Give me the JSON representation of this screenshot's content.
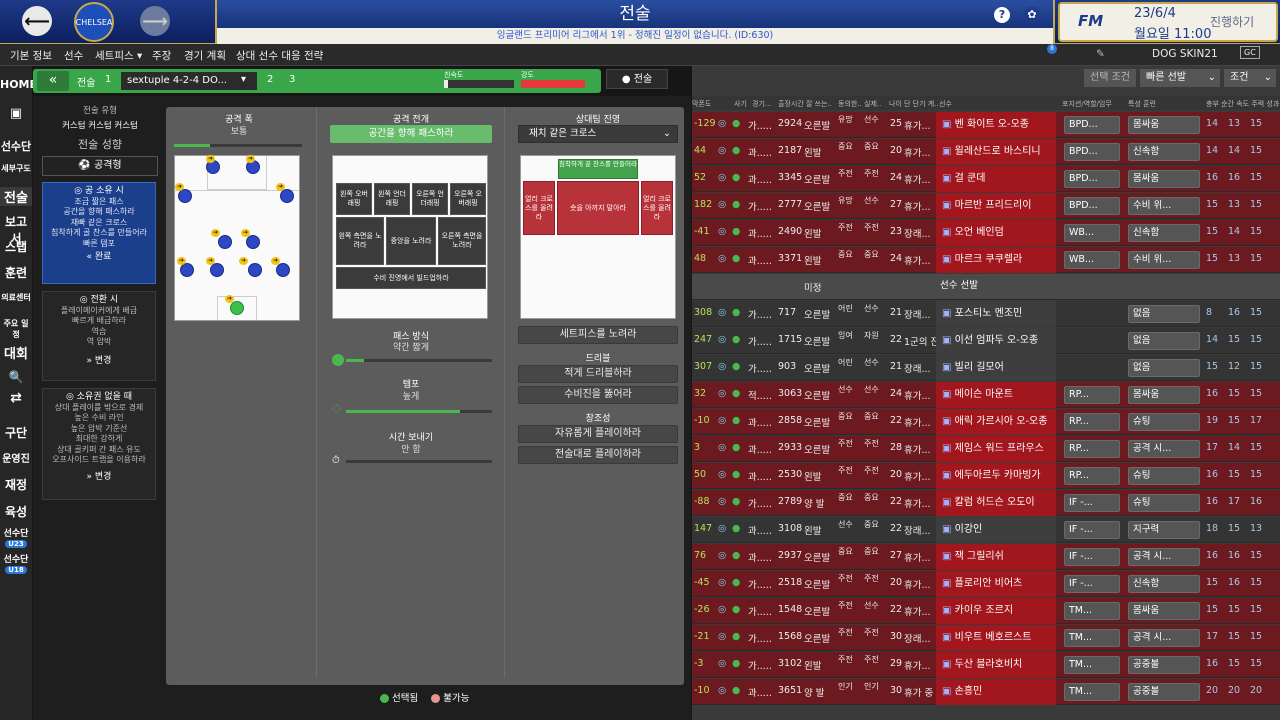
{
  "header": {
    "title": "전술",
    "subtitle": "잉글랜드 프리미어 리그에서 1위 - 정해진 일정이 없습니다. (ID:630)",
    "club_crest_text": "CHELSEA",
    "date": "23/6/4",
    "day_time": "월요일 11:00",
    "continue_label": "진행하기",
    "brand": "FM",
    "help_label": "?",
    "back_label": "⟵",
    "forward_label": "⟶"
  },
  "tabs": [
    "기본 정보",
    "선수",
    "세트피스 ▾",
    "주장",
    "경기 계획",
    "상대 선수 대응 전략"
  ],
  "skin_label": "DOG SKIN21",
  "sidebar": {
    "items": [
      "HOME",
      "선수단",
      "세부구도",
      "전술",
      "보고서",
      "스탭",
      "훈련",
      "의료센터",
      "주요 일정",
      "대회",
      "🔍",
      "⇄",
      "구단",
      "운영진",
      "재정",
      "육성",
      "선수단",
      "선수단"
    ],
    "badges": [
      "U23",
      "U18"
    ]
  },
  "tactic": {
    "collapse_label": "«",
    "label": "전술",
    "slot1": "1",
    "name": "sextuple 4-2-4 DO...",
    "slot2": "2",
    "slot3": "3",
    "familiarity_label": "친숙도",
    "intensity_label": "강도",
    "menu_label": "● 전술"
  },
  "left": {
    "style_label": "전술 유형",
    "style_value": "커스텀 커스텀 커스텀",
    "mentality_label": "전술 성향",
    "mentality_value": "⚽ 공격형",
    "in_possession": {
      "title": "◎ 공 소유 시",
      "lines": [
        "조금 짧은 패스",
        "공간을 향해 패스하라",
        "재빠 같은 크로스",
        "침착하게 골 찬스를 만들어라",
        "빠른 템포"
      ],
      "button": "« 완료"
    },
    "transition": {
      "title": "◎ 전환 시",
      "lines": [
        "플레이메이커에게 배급",
        "빠르게 배급하라",
        "역습",
        "역 압박"
      ],
      "button": "» 변경"
    },
    "out_possession": {
      "title": "◎ 소유권 없을 때",
      "lines": [
        "상대 플레이를 밖으로 경제",
        "높은 수비 라인",
        "높은 압박 기준선",
        "최대한 강하게",
        "상대 골키퍼 간 패스 유도",
        "오프사이드 트랩을 이용하라"
      ],
      "button": "» 변경"
    }
  },
  "main": {
    "width_title": "공격 폭",
    "width_value": "보통",
    "width_level_pct": 28,
    "attack_title": "공격 전개",
    "attack_value": "공간을 향해 패스하라",
    "zones": [
      "왼쪽 오버래핑",
      "왼쪽 언더래핑",
      "오른쪽 언더래핑",
      "오른쪽 오버래핑",
      "왼쪽 측면을 노려라",
      "중앙을 노려라",
      "오른쪽 측면을 노려라",
      "수비 진영에서 빌드업하라"
    ],
    "pass_title": "패스 방식",
    "pass_value": "약간 짧게",
    "pass_level_pct": 12,
    "tempo_title": "템포",
    "tempo_value": "높게",
    "tempo_level_pct": 78,
    "time_title": "시간 보내기",
    "time_value": "안 함",
    "time_level_pct": 0,
    "opp_title": "상대팀 진영",
    "opp_value": "재치 같은 크로스",
    "opp_zones": [
      "침착하게 골 찬스를 만들어라",
      "얼리 크로스를 올려라",
      "숏을 아끼지 말아라",
      "얼리 크로스를 올려라"
    ],
    "setpiece_btn": "세트피스를 노려라",
    "dribble_title": "드리블",
    "dribble_btns": [
      "적게 드리블하라",
      "수비진을 뚫어라"
    ],
    "creative_title": "창조성",
    "creative_btns": [
      "자유롭게 플레이하라",
      "전술대로 플레이하라"
    ],
    "legend_selected": "선택됨",
    "legend_unavailable": "불가능"
  },
  "right": {
    "filter_btn": "선택 조건",
    "quick_btn": "빠른 선발",
    "cond_btn": "조건",
    "headers": [
      "막폰도",
      "사기",
      "경기...",
      "출장시간 잘 쓰는..",
      "동의한..",
      "실제..",
      "나이",
      "단 단기 계..",
      "선수",
      "포지션/역할/임무",
      "특성 훈련",
      "충부 순간 속도 주력 성과"
    ],
    "sub_label": "미정",
    "sub_select": "선수 선발",
    "rows": [
      {
        "diff": "-129",
        "cond": "가.....",
        "val": "2924",
        "foot": "오른발",
        "a": "유망",
        "b": "선수",
        "age": "25",
        "contract": "휴가...",
        "name": "벤 화이트 오-오종",
        "role": "BPD...",
        "train": "몸싸움",
        "s1": "14",
        "s2": "13",
        "s3": "15",
        "red": true
      },
      {
        "diff": "44",
        "cond": "과.....",
        "val": "2187",
        "foot": "왼발",
        "a": "중요",
        "b": "중요",
        "age": "20",
        "contract": "휴가...",
        "name": "윌레산드로 바스티니",
        "role": "BPD...",
        "train": "신속함",
        "s1": "14",
        "s2": "14",
        "s3": "15",
        "red": true
      },
      {
        "diff": "52",
        "cond": "과.....",
        "val": "3345",
        "foot": "오른발",
        "a": "주전",
        "b": "주전",
        "age": "24",
        "contract": "휴가...",
        "name": "걸 쿤데",
        "role": "BPD...",
        "train": "몸싸움",
        "s1": "16",
        "s2": "16",
        "s3": "15",
        "red": true
      },
      {
        "diff": "182",
        "cond": "가.....",
        "val": "2777",
        "foot": "오른발",
        "a": "유망",
        "b": "선수",
        "age": "27",
        "contract": "휴가...",
        "name": "마르반 프리드리이",
        "role": "BPD...",
        "train": "수비 위...",
        "s1": "15",
        "s2": "13",
        "s3": "15",
        "red": true
      },
      {
        "diff": "-41",
        "cond": "과.....",
        "val": "2490",
        "foot": "왼발",
        "a": "주전",
        "b": "주전",
        "age": "23",
        "contract": "장래...",
        "name": "오언 베인덤",
        "role": "WB...",
        "train": "신속함",
        "s1": "15",
        "s2": "14",
        "s3": "15",
        "red": true
      },
      {
        "diff": "48",
        "cond": "과.....",
        "val": "3371",
        "foot": "왼발",
        "a": "중요",
        "b": "중요",
        "age": "24",
        "contract": "휴가...",
        "name": "마르크 쿠쿠렐라",
        "role": "WB...",
        "train": "수비 위...",
        "s1": "15",
        "s2": "13",
        "s3": "15",
        "red": true
      },
      {
        "diff": "308",
        "cond": "가.....",
        "val": "717",
        "foot": "오른발",
        "a": "어린",
        "b": "선수",
        "age": "21",
        "contract": "장래...",
        "name": "포스티노 멘조민",
        "role": "",
        "train": "없음",
        "s1": "8",
        "s2": "16",
        "s3": "15",
        "red": false
      },
      {
        "diff": "247",
        "cond": "가.....",
        "val": "1715",
        "foot": "오른발",
        "a": "잉여",
        "b": "자원",
        "age": "22",
        "contract": "1군의 잔",
        "name": "이선 엄파두 오-오종",
        "role": "",
        "train": "없음",
        "s1": "14",
        "s2": "15",
        "s3": "15",
        "red": false
      },
      {
        "diff": "307",
        "cond": "가.....",
        "val": "903",
        "foot": "오른발",
        "a": "어린",
        "b": "선수",
        "age": "21",
        "contract": "장래...",
        "name": "빌리 길모어",
        "role": "",
        "train": "없음",
        "s1": "15",
        "s2": "12",
        "s3": "15",
        "red": false
      },
      {
        "diff": "32",
        "cond": "적.....",
        "val": "3063",
        "foot": "오른발",
        "a": "선수",
        "b": "선수",
        "age": "24",
        "contract": "휴가...",
        "name": "메이슨 마운트",
        "role": "RP...",
        "train": "몸싸움",
        "s1": "16",
        "s2": "15",
        "s3": "15",
        "red": true
      },
      {
        "diff": "-10",
        "cond": "과.....",
        "val": "2858",
        "foot": "오른발",
        "a": "중요",
        "b": "중요",
        "age": "22",
        "contract": "휴가...",
        "name": "애릭 가르시아 오-오종",
        "role": "RP...",
        "train": "슈팅",
        "s1": "19",
        "s2": "15",
        "s3": "17",
        "red": true
      },
      {
        "diff": "3",
        "cond": "과.....",
        "val": "2933",
        "foot": "오른발",
        "a": "주전",
        "b": "주전",
        "age": "28",
        "contract": "휴가...",
        "name": "제임스 워드 프라우스",
        "role": "RP...",
        "train": "공격 시...",
        "s1": "17",
        "s2": "14",
        "s3": "15",
        "red": true
      },
      {
        "diff": "50",
        "cond": "과.....",
        "val": "2530",
        "foot": "왼발",
        "a": "주전",
        "b": "주전",
        "age": "20",
        "contract": "휴가...",
        "name": "에두아르두 카마빙가",
        "role": "RP...",
        "train": "슈팅",
        "s1": "16",
        "s2": "15",
        "s3": "15",
        "red": true
      },
      {
        "diff": "-88",
        "cond": "가.....",
        "val": "2789",
        "foot": "양 발",
        "a": "중요",
        "b": "중요",
        "age": "22",
        "contract": "휴가...",
        "name": "칼럼 허드슨 오도이",
        "role": "IF -...",
        "train": "슈팅",
        "s1": "16",
        "s2": "17",
        "s3": "16",
        "red": true
      },
      {
        "diff": "147",
        "cond": "과.....",
        "val": "3108",
        "foot": "왼발",
        "a": "선수",
        "b": "중요",
        "age": "22",
        "contract": "장래...",
        "name": "이강인",
        "role": "IF -...",
        "train": "지구력",
        "s1": "18",
        "s2": "15",
        "s3": "13",
        "red": false
      },
      {
        "diff": "76",
        "cond": "과.....",
        "val": "2937",
        "foot": "오른발",
        "a": "중요",
        "b": "중요",
        "age": "27",
        "contract": "휴가...",
        "name": "잭 그릴리쉬",
        "role": "IF -...",
        "train": "공격 시...",
        "s1": "16",
        "s2": "16",
        "s3": "15",
        "red": true
      },
      {
        "diff": "-45",
        "cond": "가.....",
        "val": "2518",
        "foot": "오른발",
        "a": "주전",
        "b": "주전",
        "age": "20",
        "contract": "휴가...",
        "name": "플로리안 비어츠",
        "role": "IF -...",
        "train": "신속함",
        "s1": "15",
        "s2": "16",
        "s3": "15",
        "red": true
      },
      {
        "diff": "-26",
        "cond": "가.....",
        "val": "1548",
        "foot": "오른발",
        "a": "주전",
        "b": "선수",
        "age": "22",
        "contract": "휴가...",
        "name": "카이우 조르지",
        "role": "TM...",
        "train": "몸싸움",
        "s1": "15",
        "s2": "15",
        "s3": "15",
        "red": true
      },
      {
        "diff": "-21",
        "cond": "가.....",
        "val": "1568",
        "foot": "오른발",
        "a": "주전",
        "b": "주전",
        "age": "30",
        "contract": "장래...",
        "name": "비우트 베호르스트",
        "role": "TM...",
        "train": "공격 시...",
        "s1": "17",
        "s2": "15",
        "s3": "15",
        "red": true
      },
      {
        "diff": "-3",
        "cond": "가.....",
        "val": "3102",
        "foot": "왼발",
        "a": "주전",
        "b": "주전",
        "age": "29",
        "contract": "휴가...",
        "name": "두산 블라호비치",
        "role": "TM...",
        "train": "공중볼",
        "s1": "16",
        "s2": "15",
        "s3": "15",
        "red": true
      },
      {
        "diff": "-10",
        "cond": "과.....",
        "val": "3651",
        "foot": "양 발",
        "a": "인기",
        "b": "인기",
        "age": "30",
        "contract": "휴가 중",
        "name": "손흥민",
        "role": "TM...",
        "train": "공중볼",
        "s1": "20",
        "s2": "20",
        "s3": "20",
        "red": true
      }
    ]
  },
  "colors": {
    "accent_green": "#3aa64a",
    "brand_blue": "#1f3a8a",
    "player_red": "#a2161d"
  }
}
